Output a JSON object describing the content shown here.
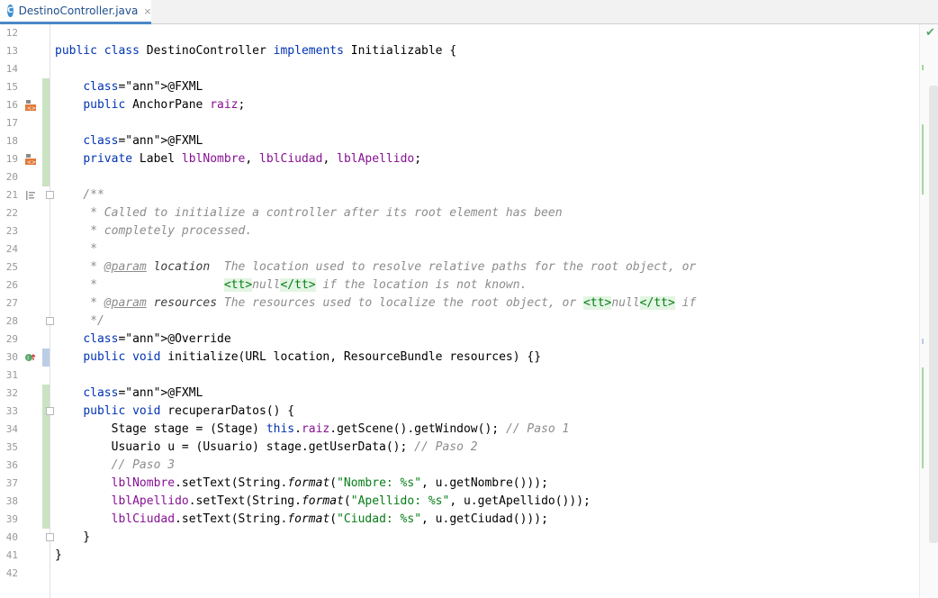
{
  "tab": {
    "icon_letter": "C",
    "label": "DestinoController.java",
    "close": "×"
  },
  "status_icon": "check-icon",
  "colors": {
    "keyword": "#0033b3",
    "annotation": "#9e880d",
    "field": "#871094",
    "comment": "#8c8c8c",
    "string": "#067d17",
    "added_change": "#c9e3c3"
  },
  "lines": [
    {
      "n": "12",
      "t": ""
    },
    {
      "n": "13",
      "t": "public class DestinoController implements Initializable {"
    },
    {
      "n": "14",
      "t": ""
    },
    {
      "n": "15",
      "t": "    @FXML"
    },
    {
      "n": "16",
      "t": "    public AnchorPane raiz;"
    },
    {
      "n": "17",
      "t": ""
    },
    {
      "n": "18",
      "t": "    @FXML"
    },
    {
      "n": "19",
      "t": "    private Label lblNombre, lblCiudad, lblApellido;"
    },
    {
      "n": "20",
      "t": ""
    },
    {
      "n": "21",
      "t": "    /**"
    },
    {
      "n": "22",
      "t": "     * Called to initialize a controller after its root element has been"
    },
    {
      "n": "23",
      "t": "     * completely processed."
    },
    {
      "n": "24",
      "t": "     *"
    },
    {
      "n": "25",
      "t": "     * @param location  The location used to resolve relative paths for the root object, or"
    },
    {
      "n": "26",
      "t": "     *                  <tt>null</tt> if the location is not known."
    },
    {
      "n": "27",
      "t": "     * @param resources The resources used to localize the root object, or <tt>null</tt> if"
    },
    {
      "n": "28",
      "t": "     */"
    },
    {
      "n": "29",
      "t": "    @Override"
    },
    {
      "n": "30",
      "t": "    public void initialize(URL location, ResourceBundle resources) {}"
    },
    {
      "n": "31",
      "t": ""
    },
    {
      "n": "32",
      "t": "    @FXML"
    },
    {
      "n": "33",
      "t": "    public void recuperarDatos() {"
    },
    {
      "n": "34",
      "t": "        Stage stage = (Stage) this.raiz.getScene().getWindow(); // Paso 1"
    },
    {
      "n": "35",
      "t": "        Usuario u = (Usuario) stage.getUserData(); // Paso 2"
    },
    {
      "n": "36",
      "t": "        // Paso 3"
    },
    {
      "n": "37",
      "t": "        lblNombre.setText(String.format(\"Nombre: %s\", u.getNombre()));"
    },
    {
      "n": "38",
      "t": "        lblApellido.setText(String.format(\"Apellido: %s\", u.getApellido()));"
    },
    {
      "n": "39",
      "t": "        lblCiudad.setText(String.format(\"Ciudad: %s\", u.getCiudad()));"
    },
    {
      "n": "40",
      "t": "    }"
    },
    {
      "n": "41",
      "t": "}"
    },
    {
      "n": "42",
      "t": ""
    }
  ]
}
